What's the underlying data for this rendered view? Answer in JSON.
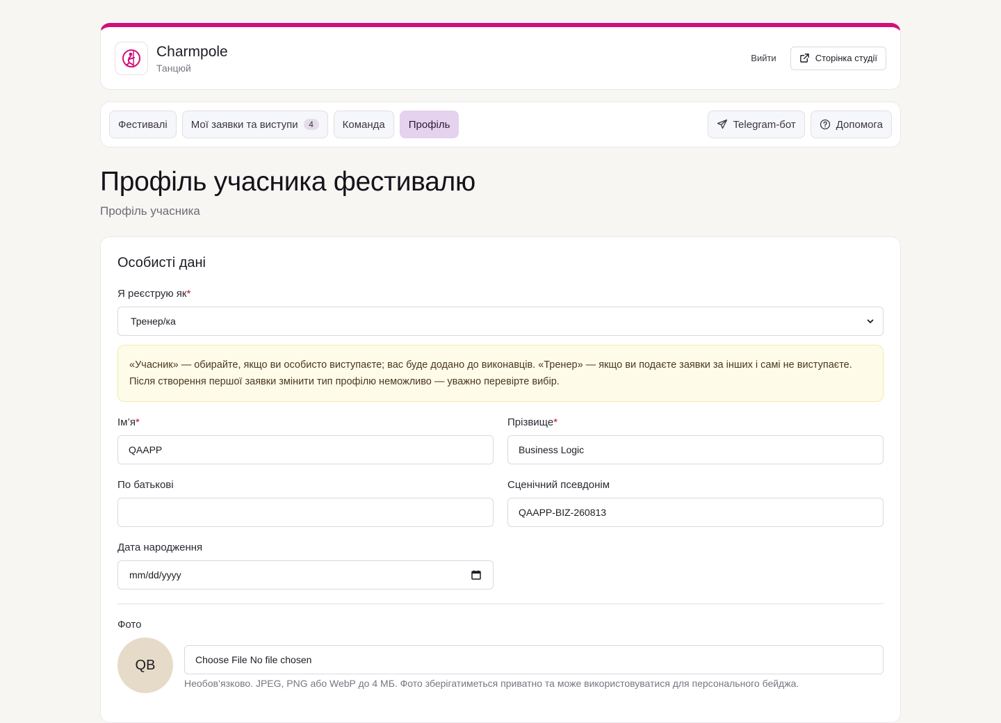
{
  "header": {
    "brand_name": "Charmpole",
    "brand_sub": "Танцюй",
    "logout_label": "Вийти",
    "studio_label": "Сторінка студії",
    "accent_color": "#d10f7a"
  },
  "nav": {
    "tabs": [
      {
        "label": "Фестивалі"
      },
      {
        "label": "Мої заявки та виступи",
        "badge": "4"
      },
      {
        "label": "Команда"
      },
      {
        "label": "Профіль",
        "active": true
      }
    ],
    "telegram_label": "Telegram-бот",
    "help_label": "Допомога"
  },
  "page": {
    "title": "Профіль учасника фестивалю",
    "subtitle": "Профіль учасника"
  },
  "form": {
    "section_title": "Особисті дані",
    "register_as_label": "Я реєструю як",
    "register_as_value": "Тренер/ка",
    "note": "«Учасник» — обирайте, якщо ви особисто виступаєте; вас буде додано до виконавців. «Тренер» — якщо ви подаєте заявки за інших і самі не виступаєте. Після створення першої заявки змінити тип профілю неможливо — уважно перевірте вибір.",
    "first_name_label": "Ім’я",
    "first_name_value": "QAAPP",
    "last_name_label": "Прізвище",
    "last_name_value": "Business Logic",
    "patronymic_label": "По батькові",
    "patronymic_value": "",
    "stage_name_label": "Сценічний псевдонім",
    "stage_name_value": "QAAPP-BIZ-260813",
    "birth_date_label": "Дата народження",
    "birth_date_placeholder": "mm/dd/yyyy",
    "required_mark": "*",
    "photo_label": "Фото",
    "avatar_initials": "QB",
    "file_button": "Choose File",
    "file_status": "No file chosen",
    "photo_hint": "Необов’язково. JPEG, PNG або WebP до 4 МБ. Фото зберігатиметься приватно та може використовуватися для персонального бейджа."
  }
}
